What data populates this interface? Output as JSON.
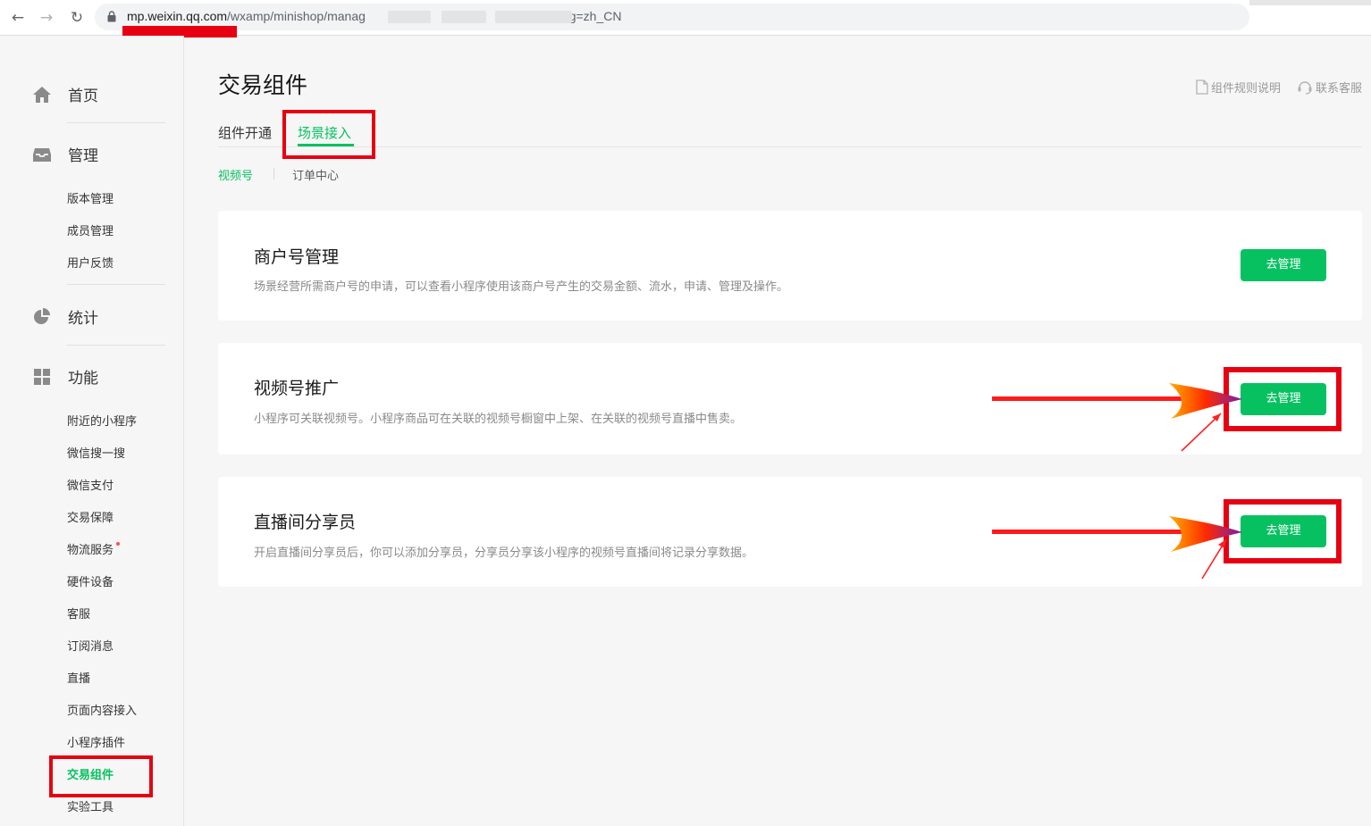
{
  "browser": {
    "url_domain": "mp.weixin.qq.com",
    "url_path": "/wxamp/minishop/manag",
    "url_tail": "ng=zh_CN"
  },
  "sidebar": {
    "groups": [
      {
        "label": "首页",
        "icon": "home-icon"
      },
      {
        "label": "管理",
        "icon": "inbox-icon"
      },
      {
        "label": "统计",
        "icon": "pie-chart-icon"
      },
      {
        "label": "功能",
        "icon": "grid-icon"
      }
    ],
    "manage_items": [
      "版本管理",
      "成员管理",
      "用户反馈"
    ],
    "feature_items": [
      "附近的小程序",
      "微信搜一搜",
      "微信支付",
      "交易保障",
      "物流服务",
      "硬件设备",
      "客服",
      "订阅消息",
      "直播",
      "页面内容接入",
      "小程序插件",
      "交易组件",
      "实验工具"
    ],
    "active_item": "交易组件"
  },
  "main": {
    "title": "交易组件",
    "links": [
      "组件规则说明",
      "联系客服"
    ],
    "tabs": [
      "组件开通",
      "场景接入"
    ],
    "active_tab": "场景接入",
    "subtabs": [
      "视频号",
      "订单中心"
    ],
    "cards": [
      {
        "title": "商户号管理",
        "desc": "场景经营所需商户号的申请，可以查看小程序使用该商户号产生的交易金额、流水，申请、管理及操作。",
        "button": "去管理"
      },
      {
        "title": "视频号推广",
        "desc": "小程序可关联视频号。小程序商品可在关联的视频号橱窗中上架、在关联的视频号直播中售卖。",
        "button": "去管理"
      },
      {
        "title": "直播间分享员",
        "desc": "开启直播间分享员后，你可以添加分享员，分享员分享该小程序的视频号直播间将记录分享数据。",
        "button": "去管理"
      }
    ]
  },
  "colors": {
    "accent": "#07c160",
    "highlight": "#e60012"
  }
}
